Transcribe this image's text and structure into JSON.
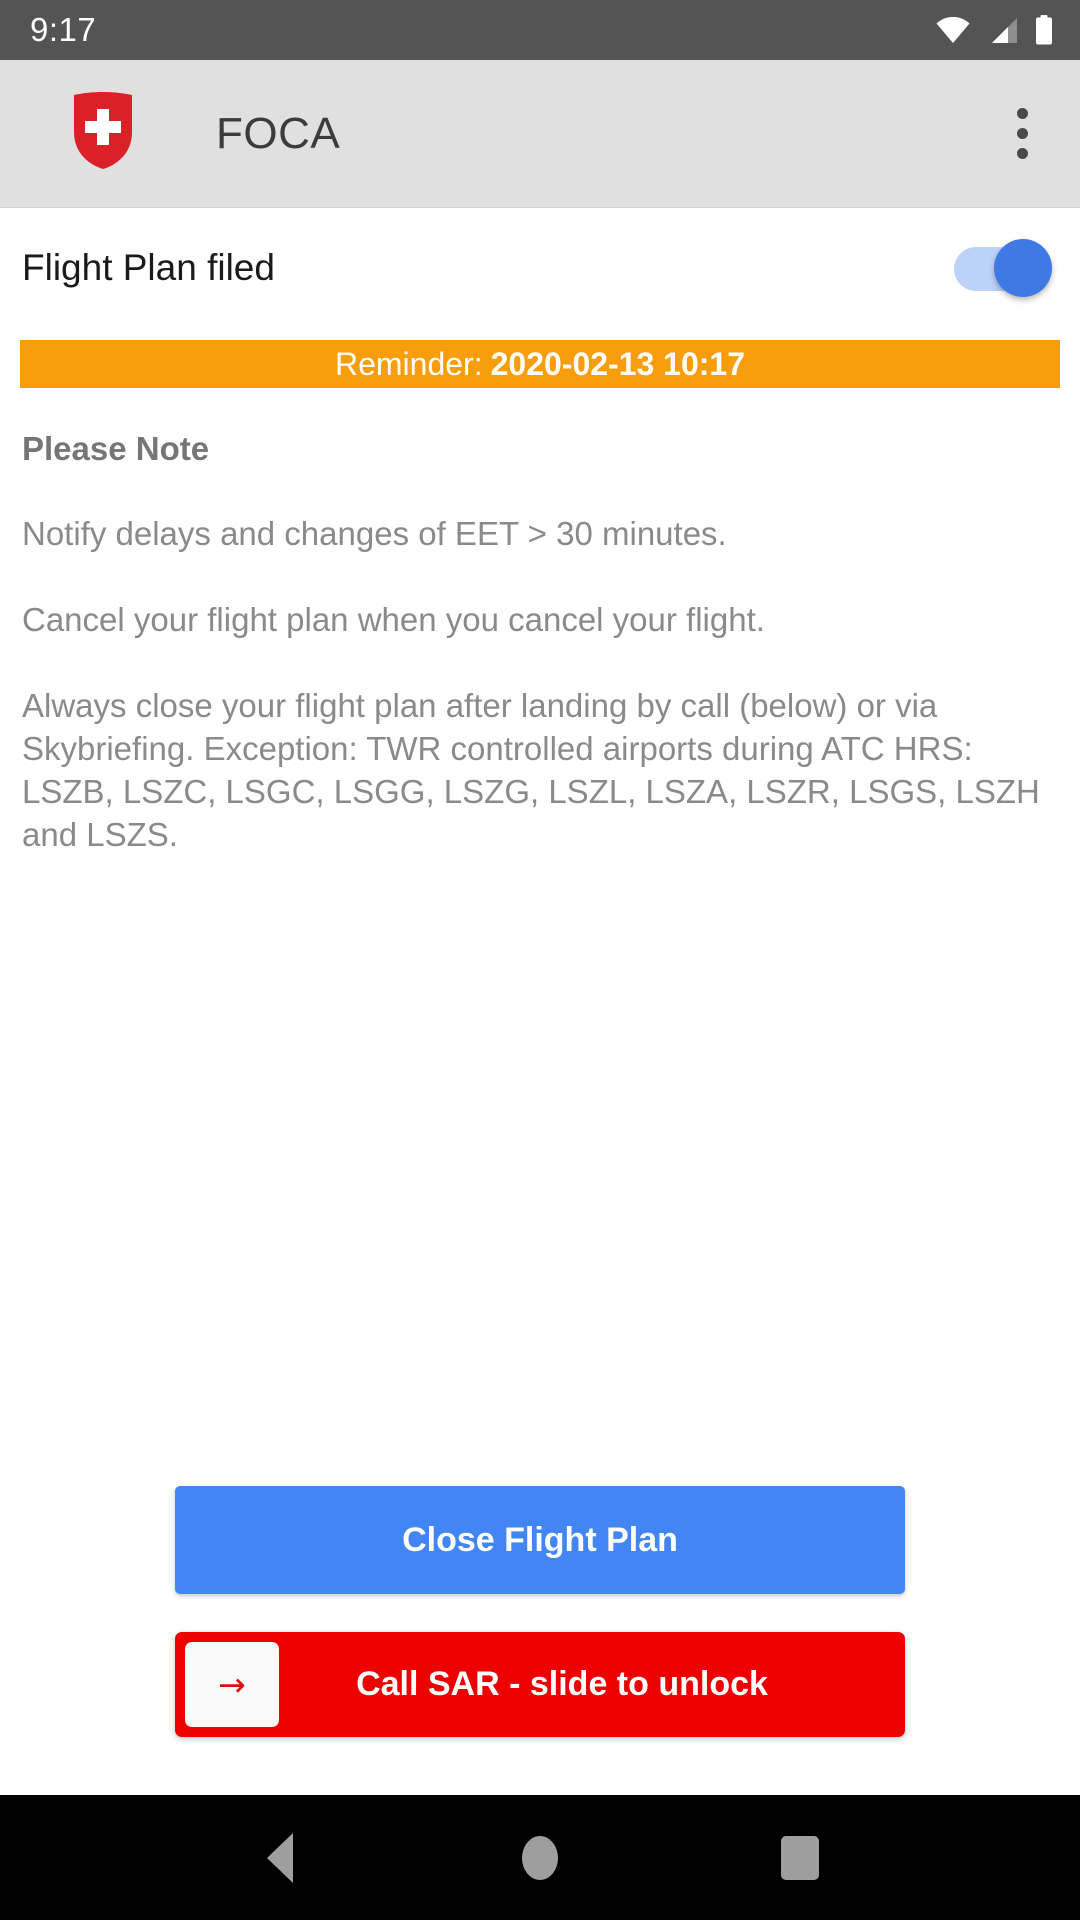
{
  "status_bar": {
    "clock": "9:17",
    "icons": [
      "wifi-icon",
      "cellular-signal-icon",
      "battery-icon"
    ]
  },
  "app_bar": {
    "logo": "swiss-coat-of-arms-shield-icon",
    "title": "FOCA",
    "overflow_menu": "more-options-icon"
  },
  "flight_plan_toggle": {
    "label": "Flight Plan filed",
    "state": "on",
    "accent_color": "#3f7ae4",
    "track_color": "#bdd2f8"
  },
  "reminder": {
    "prefix": "Reminder:",
    "datetime": "2020-02-13 10:17",
    "background_color": "#f89e0c",
    "text_color": "#ffffff"
  },
  "notes": {
    "heading": "Please Note",
    "paragraphs": [
      "Notify delays and changes of EET > 30 minutes.",
      "Cancel your flight plan when you cancel your flight.",
      "Always close your flight plan after landing by call (below) or via Skybriefing. Exception: TWR controlled airports during ATC HRS: LSZB, LSZC, LSGC, LSGG, LSZG, LSZL, LSZA, LSZR, LSGS, LSZH and LSZS."
    ]
  },
  "actions": {
    "close_flight_plan_label": "Close Flight Plan",
    "close_flight_plan_color": "#4285f4",
    "sar_slider_label": "Call SAR - slide to unlock",
    "sar_slider_color": "#ec0000",
    "sar_handle_arrow": "→"
  },
  "nav_bar": {
    "back": "back-triangle-icon",
    "home": "home-circle-icon",
    "recents": "recents-square-icon"
  }
}
